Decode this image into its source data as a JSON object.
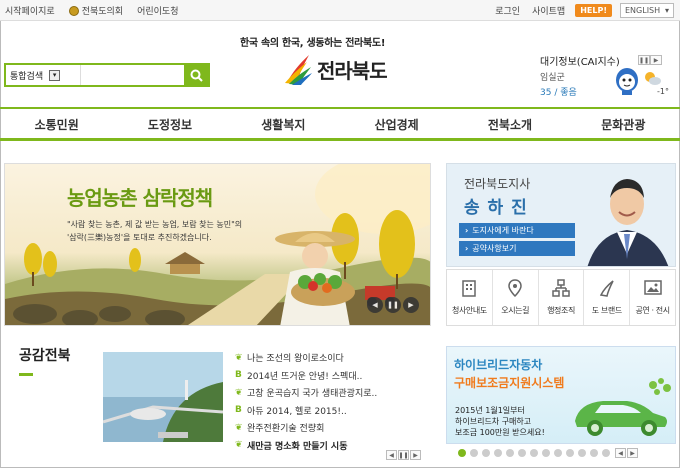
{
  "util": {
    "home": "시작페이지로",
    "council": "전북도의회",
    "kids": "어린이도청",
    "login": "로그인",
    "sitemap": "사이트맵",
    "help": "HELP!",
    "lang": "ENGLISH",
    "lang_arrow": "▾"
  },
  "header": {
    "slogan": "한국 속의 한국, 생동하는 전라북도!",
    "search_category": "통합검색",
    "search_dd": "▾",
    "logo": "전라북도"
  },
  "air": {
    "title": "대기정보(CAI지수)",
    "city": "임실군",
    "value": "35 / 좋음",
    "temp": "-1°"
  },
  "nav": [
    "소통민원",
    "도정정보",
    "생활복지",
    "산업경제",
    "전북소개",
    "문화관광"
  ],
  "banner": {
    "title": "농업농촌 삼락정책",
    "desc1": "\"사람 찾는 농촌, 제 값 받는 농업, 보람 찾는 농민\"의",
    "desc2": "'삼락(三樂)농정'을 토대로 추진하겠습니다.",
    "prev": "◀",
    "pause": "❚❚",
    "next": "▶"
  },
  "governor": {
    "sub": "전라북도지사",
    "name": "송 하 진",
    "btn1": "도지사에게 바란다",
    "btn2": "공약사항보기"
  },
  "quick": [
    {
      "label": "청사안내도",
      "icon": "building-icon"
    },
    {
      "label": "오시는길",
      "icon": "map-pin-icon"
    },
    {
      "label": "행정조직",
      "icon": "org-chart-icon"
    },
    {
      "label": "도 브랜드",
      "icon": "brand-icon"
    },
    {
      "label": "공연 · 전시",
      "icon": "gallery-icon"
    }
  ],
  "news": {
    "section_title": "공감전북",
    "items": [
      {
        "mark": "❦",
        "text": "나는 조선의 왕이로소이다"
      },
      {
        "mark": "B",
        "text": "2014년 뜨거운 안녕! 스펙대.."
      },
      {
        "mark": "❦",
        "text": "고창 운곡습지 국가 생태관광지로.."
      },
      {
        "mark": "B",
        "text": "아듀 2014, 헬로 2015!.."
      },
      {
        "mark": "❦",
        "text": "완주전환기술 전량회"
      },
      {
        "mark": "❦",
        "text": "새만금 명소화 만들기 시동"
      }
    ],
    "ctrl": [
      "◀",
      "❚❚",
      "▶"
    ]
  },
  "promo": {
    "title1": "하이브리드자동차",
    "title2": "구매보조금지원시스템",
    "d1": "2015년 1월1일부터",
    "d2": "하이브리드차 구매하고",
    "d3": "보조금 100만원 받으세요!",
    "pager_prev": "◀",
    "pager_next": "▶"
  },
  "colors": {
    "accent_green": "#7fb81c",
    "accent_blue": "#2f78bf",
    "help_orange": "#f08a1c"
  }
}
